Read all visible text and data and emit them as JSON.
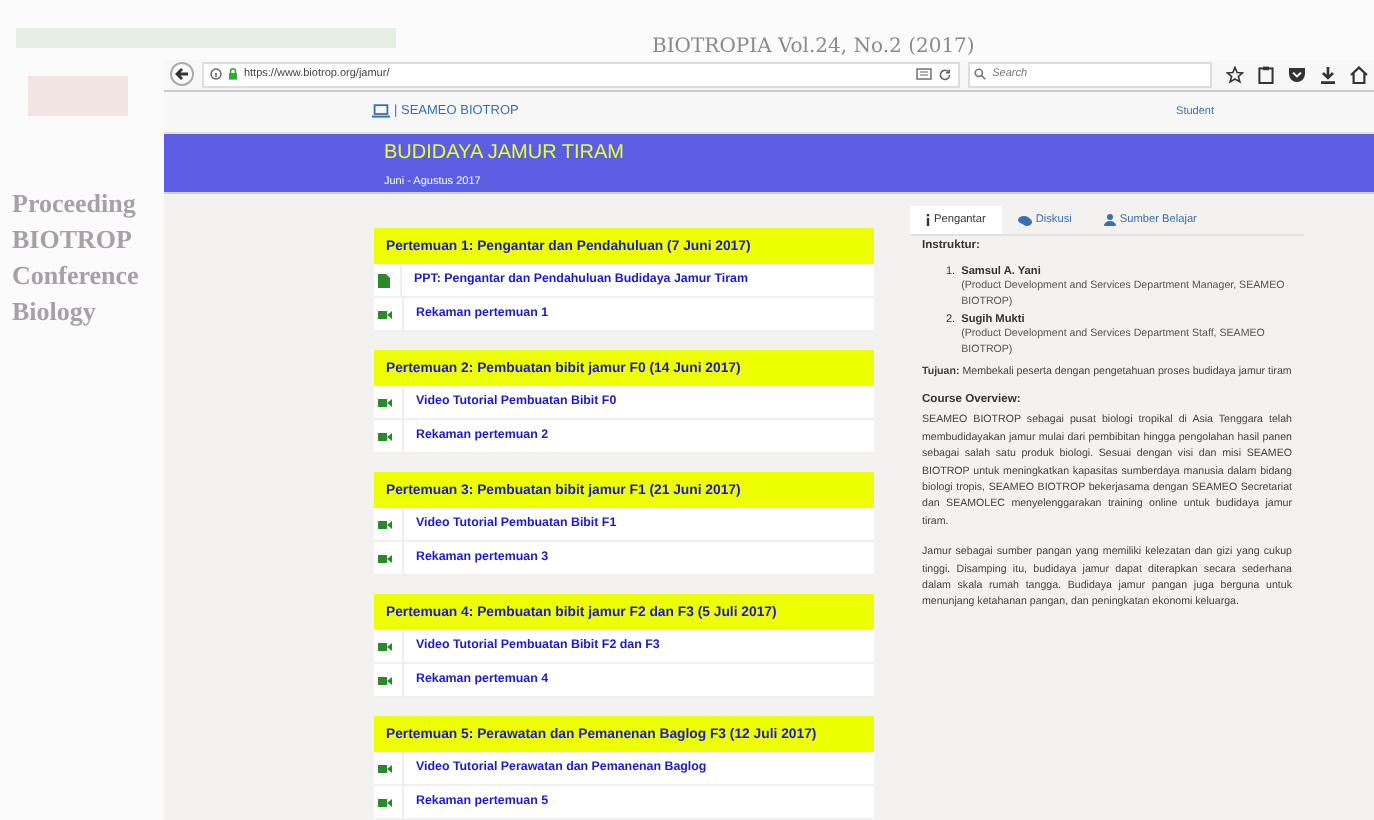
{
  "background_page": {
    "journal_title": "BIOTROPIA Vol.24, No.2 (2017)",
    "heading_lines": [
      "Proceeding",
      "BIOTROP",
      "Conference",
      "Biology"
    ]
  },
  "browser": {
    "url": "https://www.biotrop.org/jamur/",
    "search": {
      "placeholder": "Search"
    }
  },
  "navbar": {
    "brand": "| SEAMEO BIOTROP",
    "user": "Student"
  },
  "header": {
    "title": "BUDIDAYA JAMUR TIRAM",
    "subtitle": "Juni - Agustus 2017"
  },
  "sessions": [
    {
      "title": "Pertemuan 1: Pengantar dan Pendahuluan (7 Juni 2017)",
      "items": [
        {
          "kind": "document",
          "label": "PPT: Pengantar dan Pendahuluan Budidaya Jamur Tiram"
        },
        {
          "kind": "video",
          "label": "Rekaman pertemuan 1"
        }
      ]
    },
    {
      "title": "Pertemuan 2: Pembuatan bibit jamur F0 (14 Juni 2017)",
      "items": [
        {
          "kind": "video",
          "label": "Video Tutorial Pembuatan Bibit F0"
        },
        {
          "kind": "video",
          "label": "Rekaman pertemuan 2"
        }
      ]
    },
    {
      "title": "Pertemuan 3: Pembuatan bibit jamur F1 (21 Juni 2017)",
      "items": [
        {
          "kind": "video",
          "label": "Video Tutorial Pembuatan Bibit F1"
        },
        {
          "kind": "video",
          "label": "Rekaman pertemuan 3"
        }
      ]
    },
    {
      "title": "Pertemuan 4: Pembuatan bibit jamur F2 dan F3 (5 Juli 2017)",
      "items": [
        {
          "kind": "video",
          "label": "Video Tutorial Pembuatan Bibit F2 dan F3"
        },
        {
          "kind": "video",
          "label": "Rekaman pertemuan 4"
        }
      ]
    },
    {
      "title": "Pertemuan 5: Perawatan dan Pemanenan Baglog F3 (12 Juli 2017)",
      "items": [
        {
          "kind": "video",
          "label": "Video Tutorial Perawatan dan Pemanenan Baglog"
        },
        {
          "kind": "video",
          "label": "Rekaman pertemuan 5"
        }
      ]
    }
  ],
  "tabs": [
    {
      "kind": "info",
      "label": "Pengantar",
      "selected": true
    },
    {
      "kind": "chat",
      "label": "Diskusi",
      "selected": false
    },
    {
      "kind": "person",
      "label": "Sumber Belajar",
      "selected": false
    }
  ],
  "intro": {
    "instructor_label": "Instruktur:",
    "instructors": [
      {
        "number": "1.",
        "name": "Samsul A. Yani",
        "role": "(Product Development and Services Department Manager, SEAMEO BIOTROP)"
      },
      {
        "number": "2.",
        "name": "Sugih Mukti",
        "role": "(Product Development and Services Department Staff, SEAMEO BIOTROP)"
      }
    ],
    "goal": "**Tujuan:** Membekali peserta dengan pengetahuan proses budidaya jamur tiram",
    "overview_label": "Course Overview:",
    "paragraphs": [
      "SEAMEO BIOTROP sebagai pusat biologi tropikal di Asia Tenggara telah membudidayakan jamur mulai dari pembibitan hingga pengolahan hasil panen sebagai salah satu produk biologi. Sesuai dengan visi dan misi SEAMEO BIOTROP untuk meningkatkan kapasitas sumberdaya manusia dalam bidang biologi tropis, SEAMEO BIOTROP bekerjasama dengan SEAMEO Secretariat dan SEAMOLEC menyelenggarakan training online untuk budidaya jamur tiram.",
      "Jamur sebagai sumber pangan yang memiliki kelezatan dan gizi yang cukup tinggi. Disamping itu, budidaya jamur dapat diterapkan secara sederhana dalam skala rumah tangga. Budidaya jamur pangan juga berguna untuk menunjang ketahanan pangan, dan peningkatan ekonomi keluarga."
    ]
  }
}
